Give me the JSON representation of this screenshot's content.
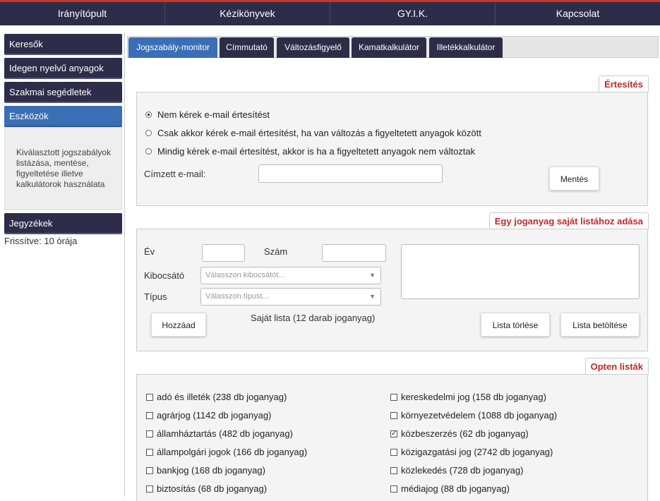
{
  "topnav": [
    "Irányítópult",
    "Kézikönyvek",
    "GY.I.K.",
    "Kapcsolat"
  ],
  "sidebar": {
    "items": [
      "Keresők",
      "Idegen nyelvű anyagok",
      "Szakmai segédletek",
      "Eszközök",
      "Jegyzékek"
    ],
    "active_description": "Kiválasztott jogszabályok listázása, mentése, figyeltetése illetve kalkulátorok használata",
    "refresh_text": "Frissítve: 10 órája"
  },
  "tabs": [
    "Jogszabály-monitor",
    "Címmutató",
    "Változásfigyelő",
    "Kamatkalkulátor",
    "Illetékkalkulátor"
  ],
  "notification": {
    "title": "Értesítés",
    "options": [
      "Nem kérek e-mail értesítést",
      "Csak akkor kérek e-mail értesítést, ha van változás a figyeltetett anyagok között",
      "Mindig kérek e-mail értesítést, akkor is ha a figyeltetett anyagok nem változtak"
    ],
    "selected_index": 0,
    "email_label": "Címzett e-mail:",
    "email_value": "",
    "save_button": "Mentés"
  },
  "add_item": {
    "title": "Egy joganyag saját listához adása",
    "year_label": "Év",
    "number_label": "Szám",
    "issuer_label": "Kibocsátó",
    "issuer_placeholder": "Válasszon kibocsátót...",
    "type_label": "Típus",
    "type_placeholder": "Válasszon típust...",
    "add_button": "Hozzáad",
    "own_list_text": "Saját lista (12 darab joganyag)",
    "clear_button": "Lista törlése",
    "load_button": "Lista betöltése"
  },
  "opten_lists": {
    "title": "Opten listák",
    "left": [
      {
        "label": "adó és illeték (238 db joganyag)",
        "checked": false
      },
      {
        "label": "agrárjog (1142 db joganyag)",
        "checked": false
      },
      {
        "label": "államháztartás (482 db joganyag)",
        "checked": false
      },
      {
        "label": "állampolgári jogok (166 db joganyag)",
        "checked": false
      },
      {
        "label": "bankjog (168 db joganyag)",
        "checked": false
      },
      {
        "label": "biztosítás (68 db joganyag)",
        "checked": false
      }
    ],
    "right": [
      {
        "label": "kereskedelmi jog (158 db joganyag)",
        "checked": false
      },
      {
        "label": "környezetvédelem (1088 db joganyag)",
        "checked": false
      },
      {
        "label": "közbeszerzés (62 db joganyag)",
        "checked": true
      },
      {
        "label": "közigazgatási jog (2742 db joganyag)",
        "checked": false
      },
      {
        "label": "közlekedés (728 db joganyag)",
        "checked": false
      },
      {
        "label": "médiajog (88 db joganyag)",
        "checked": false
      }
    ]
  },
  "colors": {
    "nav_dark": "#2d2d4a",
    "accent_red": "#c0282d",
    "active_blue": "#3a6fb5"
  }
}
